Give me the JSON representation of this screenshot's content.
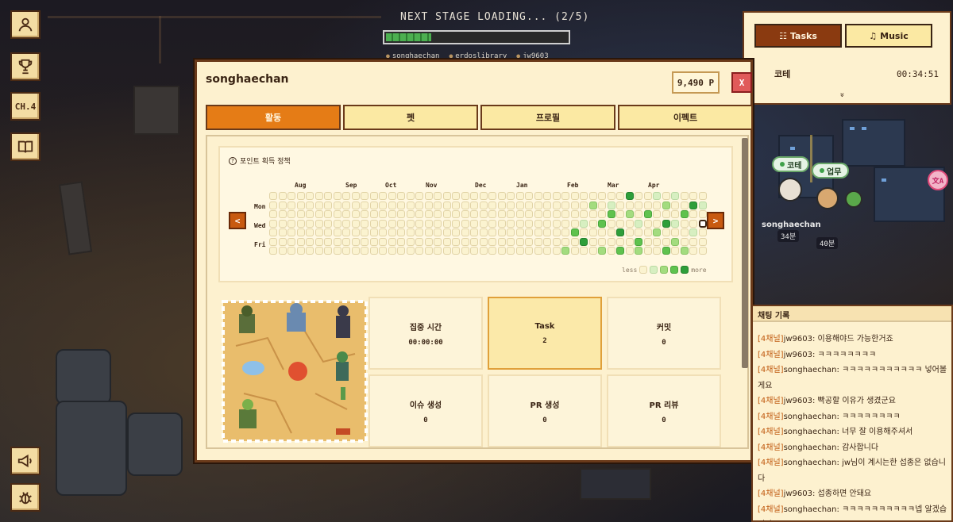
{
  "sidebar": {
    "items": [
      {
        "icon": "user-icon",
        "label": ""
      },
      {
        "icon": "trophy-icon",
        "label": ""
      },
      {
        "icon": "chapter-badge",
        "label": "CH.4"
      },
      {
        "icon": "book-icon",
        "label": ""
      }
    ],
    "bottom": [
      {
        "icon": "megaphone-icon"
      },
      {
        "icon": "bug-icon"
      }
    ]
  },
  "loading": {
    "title": "NEXT STAGE LOADING... (2/5)",
    "progress": 0.25,
    "users": [
      "songhaechan",
      "erdoslibrary",
      "jw9603"
    ]
  },
  "modal": {
    "username": "songhaechan",
    "points": "9,490 P",
    "close_label": "X",
    "tabs": [
      "활동",
      "펫",
      "프로필",
      "이펙트"
    ],
    "active_tab": "활동",
    "policy_link": "포인트 획득 정책",
    "help_symbol": "?",
    "months": [
      "Aug",
      "Sep",
      "Oct",
      "Nov",
      "Dec",
      "Jan",
      "Feb",
      "Mar",
      "Apr"
    ],
    "days": [
      "Mon",
      "Wed",
      "Fri"
    ],
    "prev_label": "<",
    "next_label": ">",
    "legend": {
      "less": "less",
      "more": "more"
    },
    "stats": [
      {
        "label": "집중 시간",
        "value": "00:00:00"
      },
      {
        "label": "Task",
        "value": "2"
      },
      {
        "label": "커밋",
        "value": "0"
      },
      {
        "label": "이슈 생성",
        "value": "0"
      },
      {
        "label": "PR 생성",
        "value": "0"
      },
      {
        "label": "PR 리뷰",
        "value": "0"
      }
    ]
  },
  "task_panel": {
    "tabs": [
      "Tasks",
      "Music"
    ],
    "active_tab": "Tasks",
    "task": {
      "name": "코테",
      "time": "00:34:51"
    },
    "expand_symbol": "»"
  },
  "world": {
    "bubbles": [
      "코테",
      "업무"
    ],
    "players": [
      {
        "name": "songhaechan",
        "badge": "34분"
      },
      {
        "name": "",
        "badge": "40분"
      }
    ],
    "translate_label": "文A"
  },
  "chat": {
    "title": "채팅 기록",
    "messages": [
      {
        "channel": "[4채널]",
        "name": "jw9603",
        "text": "이용해야드 가능한거죠"
      },
      {
        "channel": "[4채널]",
        "name": "jw9603",
        "text": "ㅋㅋㅋㅋㅋㅋㅋㅋ"
      },
      {
        "channel": "[4채널]",
        "name": "songhaechan",
        "text": "ㅋㅋㅋㅋㅋㅋㅋㅋㅋㅋㅋ 넣어볼게요"
      },
      {
        "channel": "[4채널]",
        "name": "jw9603",
        "text": "빡공할 이유가 생겼군요"
      },
      {
        "channel": "[4채널]",
        "name": "songhaechan",
        "text": "ㅋㅋㅋㅋㅋㅋㅋㅋ"
      },
      {
        "channel": "[4채널]",
        "name": "songhaechan",
        "text": "너무 잘 이용해주셔서"
      },
      {
        "channel": "[4채널]",
        "name": "songhaechan",
        "text": "감사합니다"
      },
      {
        "channel": "[4채널]",
        "name": "songhaechan",
        "text": "jw님이 계시는한 섭종은 없습니다"
      },
      {
        "channel": "[4채널]",
        "name": "jw9603",
        "text": "섭종하면 안돼요"
      },
      {
        "channel": "[4채널]",
        "name": "songhaechan",
        "text": "ㅋㅋㅋㅋㅋㅋㅋㅋㅋㅋ넵 알겠습니다 ㅎㅎㅎ"
      }
    ]
  },
  "colors": {
    "accent": "#e57c16",
    "panel": "#fdf1cf",
    "border": "#6a3a1a",
    "danger": "#e05a5a",
    "green_levels": [
      "#fbf3d0",
      "#d7efc1",
      "#a3dc7f",
      "#5fc24e",
      "#2e9e3a"
    ]
  }
}
